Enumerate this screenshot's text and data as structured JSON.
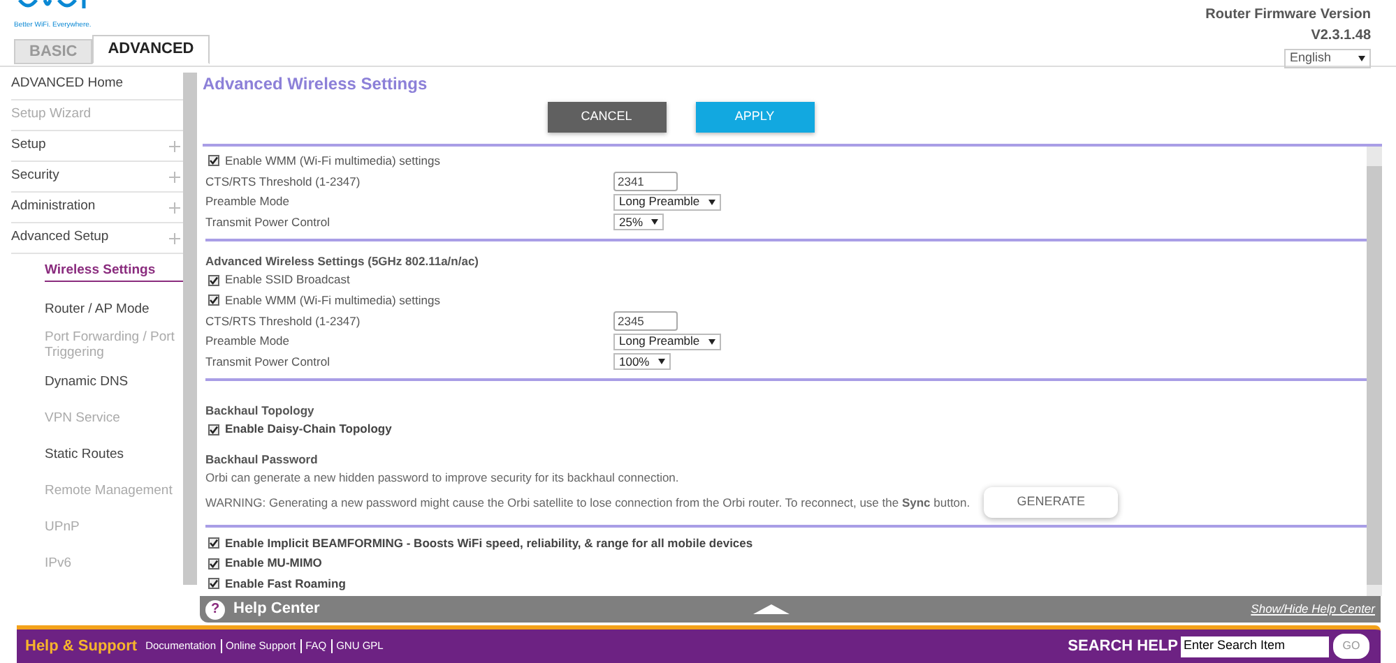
{
  "header": {
    "tagline": "Better WiFi. Everywhere.",
    "tabs": [
      {
        "label": "BASIC",
        "selected": false
      },
      {
        "label": "ADVANCED",
        "selected": true
      }
    ],
    "firmware_label": "Router Firmware Version",
    "firmware_version": "V2.3.1.48",
    "language": "English"
  },
  "sidebar": {
    "items": [
      {
        "label": "ADVANCED Home",
        "kind": "top",
        "disabled": false,
        "expandable": false,
        "selected": false
      },
      {
        "label": "Setup Wizard",
        "kind": "top",
        "disabled": true,
        "expandable": false,
        "selected": false
      },
      {
        "label": "Setup",
        "kind": "top",
        "disabled": false,
        "expandable": true,
        "selected": false
      },
      {
        "label": "Security",
        "kind": "top",
        "disabled": false,
        "expandable": true,
        "selected": false
      },
      {
        "label": "Administration",
        "kind": "top",
        "disabled": false,
        "expandable": true,
        "selected": false
      },
      {
        "label": "Advanced Setup",
        "kind": "top",
        "disabled": false,
        "expandable": true,
        "selected": false
      },
      {
        "label": "Wireless Settings",
        "kind": "sub",
        "disabled": false,
        "selected": true
      },
      {
        "label": "Router / AP Mode",
        "kind": "sub",
        "disabled": false,
        "selected": false
      },
      {
        "label": "Port Forwarding / Port Triggering",
        "kind": "sub",
        "disabled": true,
        "selected": false
      },
      {
        "label": "Dynamic DNS",
        "kind": "sub",
        "disabled": false,
        "selected": false
      },
      {
        "label": "VPN Service",
        "kind": "sub",
        "disabled": true,
        "selected": false
      },
      {
        "label": "Static Routes",
        "kind": "sub",
        "disabled": false,
        "selected": false
      },
      {
        "label": "Remote Management",
        "kind": "sub",
        "disabled": true,
        "selected": false
      },
      {
        "label": "UPnP",
        "kind": "sub",
        "disabled": true,
        "selected": false
      },
      {
        "label": "IPv6",
        "kind": "sub",
        "disabled": true,
        "selected": false
      }
    ]
  },
  "content": {
    "title": "Advanced Wireless Settings",
    "buttons": [
      {
        "label": "CANCEL",
        "kind": "cancel"
      },
      {
        "label": "APPLY",
        "kind": "apply"
      }
    ],
    "sections": [
      {
        "rows": [
          {
            "kind": "checkbox",
            "label": "Enable WMM (Wi-Fi multimedia) settings",
            "checked": true
          },
          {
            "kind": "input",
            "label": "CTS/RTS Threshold (1-2347)",
            "value": "2341"
          },
          {
            "kind": "select",
            "label": "Preamble Mode",
            "value": "Long Preamble"
          },
          {
            "kind": "select",
            "label": "Transmit Power Control",
            "value": "25%"
          }
        ]
      },
      {
        "rows": [
          {
            "kind": "heading",
            "label": "Advanced Wireless Settings (5GHz 802.11a/n/ac)"
          },
          {
            "kind": "checkbox",
            "label": "Enable SSID Broadcast",
            "checked": true
          },
          {
            "kind": "checkbox",
            "label": "Enable WMM (Wi-Fi multimedia) settings",
            "checked": true
          },
          {
            "kind": "input",
            "label": "CTS/RTS Threshold (1-2347)",
            "value": "2345"
          },
          {
            "kind": "select",
            "label": "Preamble Mode",
            "value": "Long Preamble"
          },
          {
            "kind": "select",
            "label": "Transmit Power Control",
            "value": "100%"
          }
        ]
      },
      {
        "rows": [
          {
            "kind": "heading",
            "label": "Backhaul Topology"
          },
          {
            "kind": "checkbox_strong",
            "label": "Enable Daisy-Chain Topology",
            "checked": true
          },
          {
            "kind": "heading",
            "label": "Backhaul Password"
          },
          {
            "kind": "text",
            "label": "Orbi can generate a new hidden password to improve security for its backhaul connection."
          },
          {
            "kind": "warning",
            "label": "WARNING: Generating a new password might cause the Orbi satellite to lose connection from the Orbi router. To reconnect, use the **Sync** button.",
            "button": "GENERATE"
          }
        ]
      },
      {
        "rows": [
          {
            "kind": "checkbox_strong",
            "label": "Enable Implicit BEAMFORMING - Boosts WiFi speed, reliability, & range for all mobile devices",
            "checked": true
          },
          {
            "kind": "checkbox_strong",
            "label": "Enable MU-MIMO",
            "checked": true
          },
          {
            "kind": "checkbox_strong",
            "label": "Enable Fast Roaming",
            "checked": true
          }
        ]
      }
    ]
  },
  "help_center": {
    "icon": "?",
    "label": "Help Center",
    "link": "Show/Hide Help Center"
  },
  "footer": {
    "title": "Help & Support",
    "links": [
      "Documentation",
      "Online Support",
      "FAQ",
      "GNU GPL"
    ],
    "search_label": "SEARCH HELP",
    "search_value": "Enter Search Item",
    "go": "GO"
  }
}
